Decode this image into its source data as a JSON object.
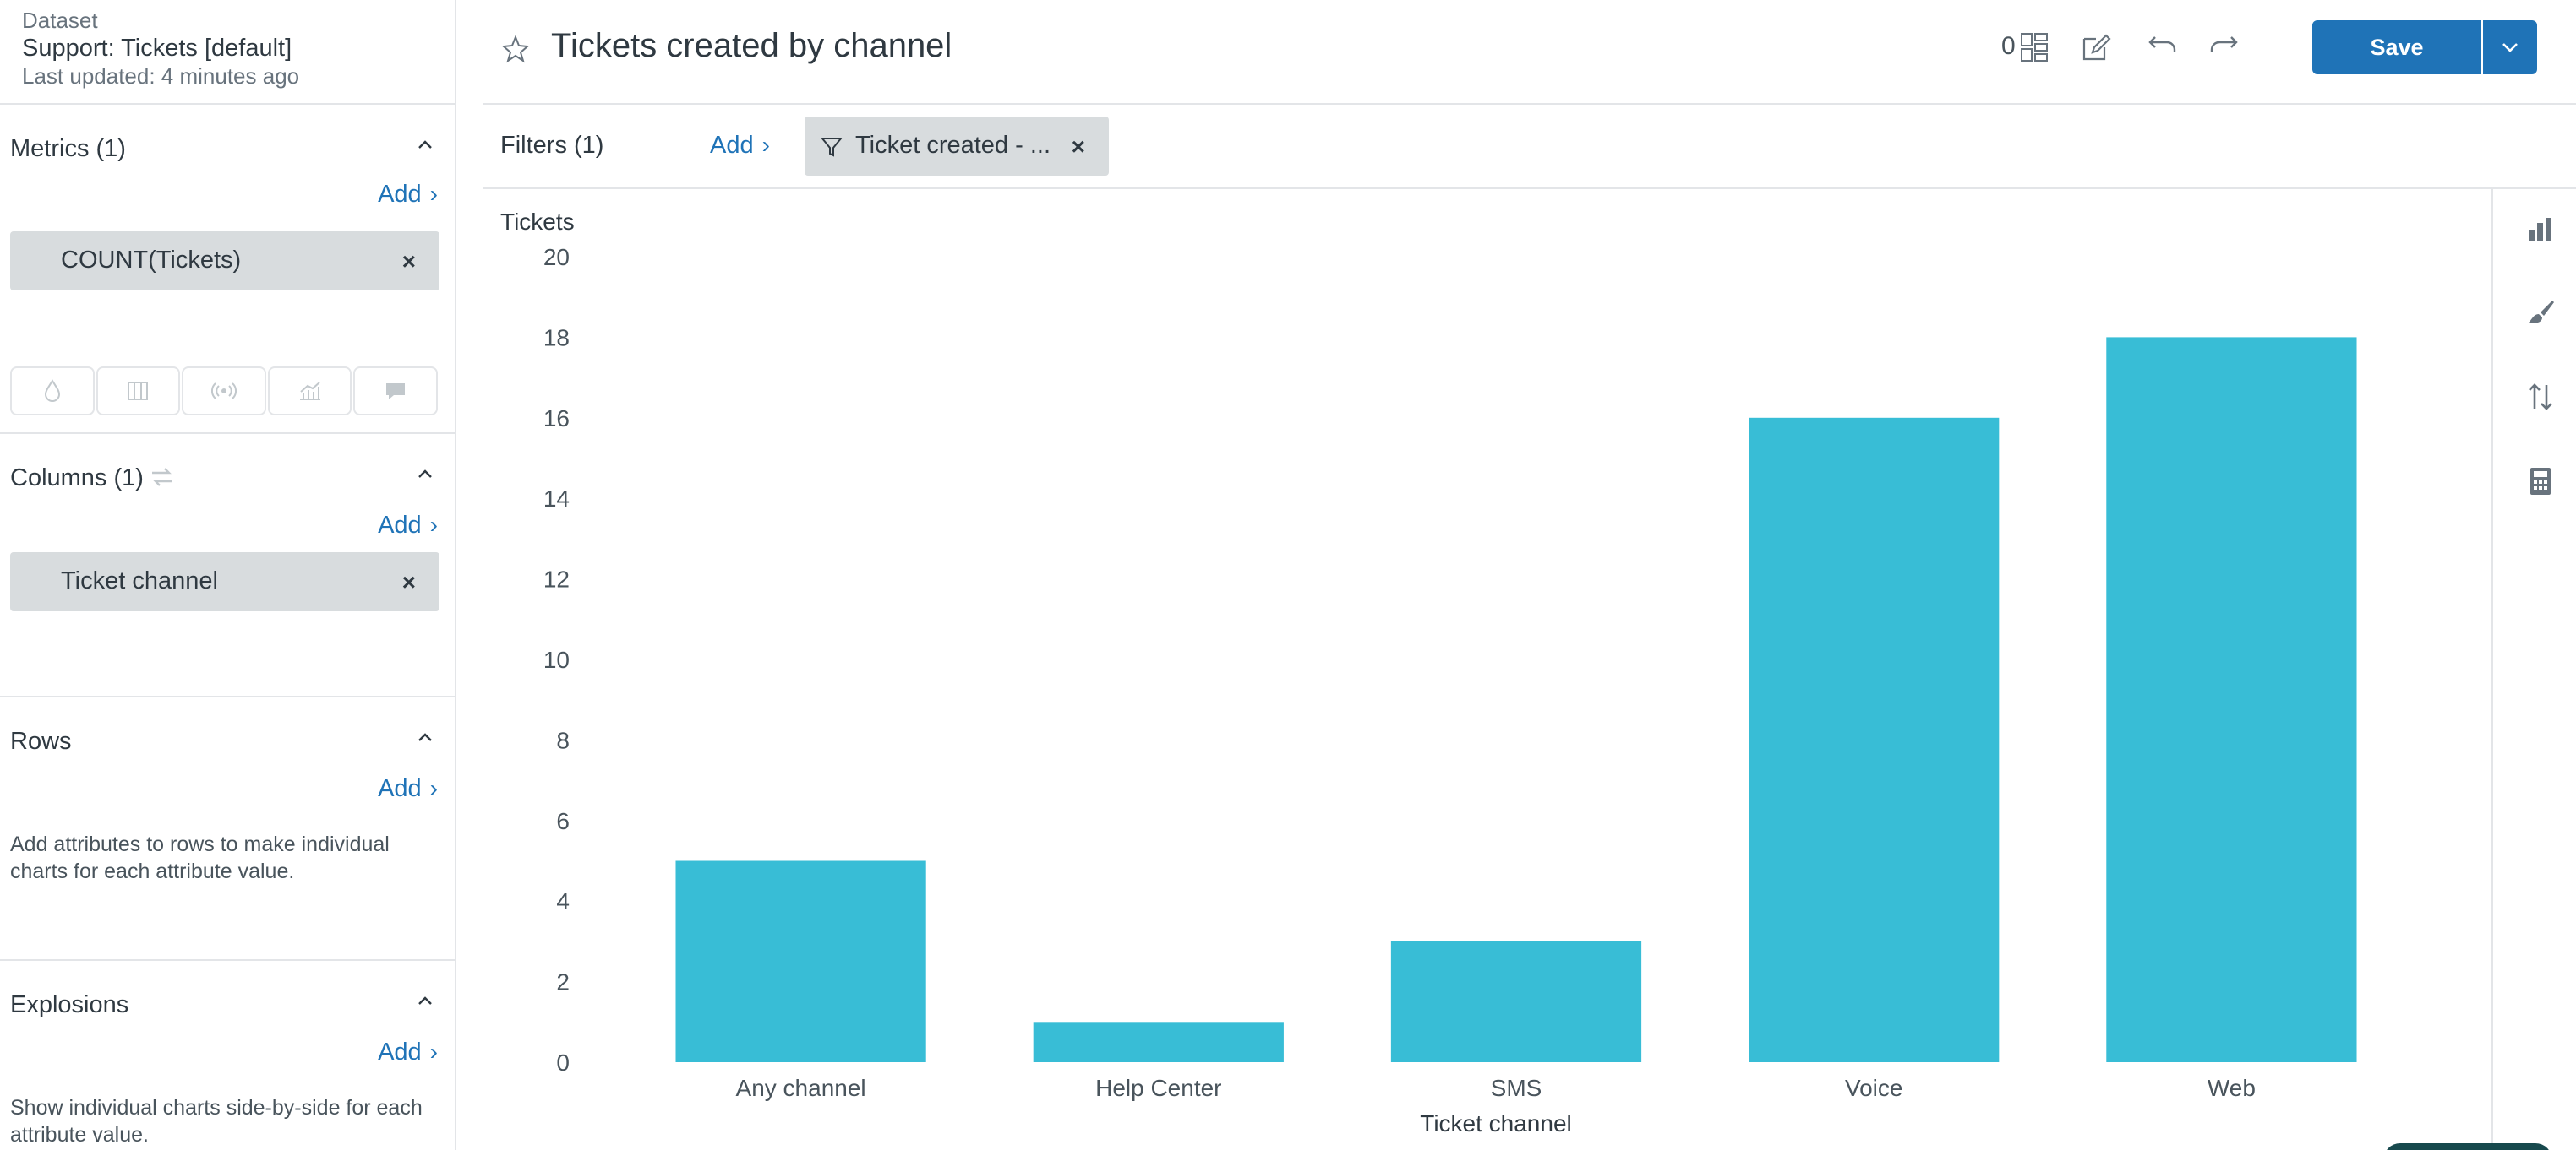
{
  "dataset": {
    "label": "Dataset",
    "name": "Support: Tickets [default]",
    "updated": "Last updated: 4 minutes ago"
  },
  "panel": {
    "metrics": {
      "title": "Metrics (1)",
      "add": "Add",
      "item": "COUNT(Tickets)"
    },
    "columns": {
      "title": "Columns (1)",
      "add": "Add",
      "item": "Ticket channel"
    },
    "rows": {
      "title": "Rows",
      "add": "Add",
      "help": "Add attributes to rows to make individual charts for each attribute value."
    },
    "explosions": {
      "title": "Explosions",
      "add": "Add",
      "help": "Show individual charts side-by-side for each attribute value."
    }
  },
  "header": {
    "title": "Tickets created by channel",
    "count": "0",
    "save_label": "Save"
  },
  "filters": {
    "label": "Filters (1)",
    "add": "Add",
    "pill": "Ticket created - ..."
  },
  "icons": {
    "arrow": "chevron-right-icon",
    "remove": "close-icon"
  },
  "colors": {
    "bar": "#38bdd6",
    "accent": "#1f73b7"
  },
  "chart_data": {
    "type": "bar",
    "categories": [
      "Any channel",
      "Help Center",
      "SMS",
      "Voice",
      "Web"
    ],
    "values": [
      5,
      1,
      3,
      16,
      18
    ],
    "ylabel": "Tickets",
    "xlabel": "Ticket channel",
    "ylim": [
      0,
      20
    ],
    "yticks": [
      0,
      2,
      4,
      6,
      8,
      10,
      12,
      14,
      16,
      18,
      20
    ],
    "grid": false
  }
}
